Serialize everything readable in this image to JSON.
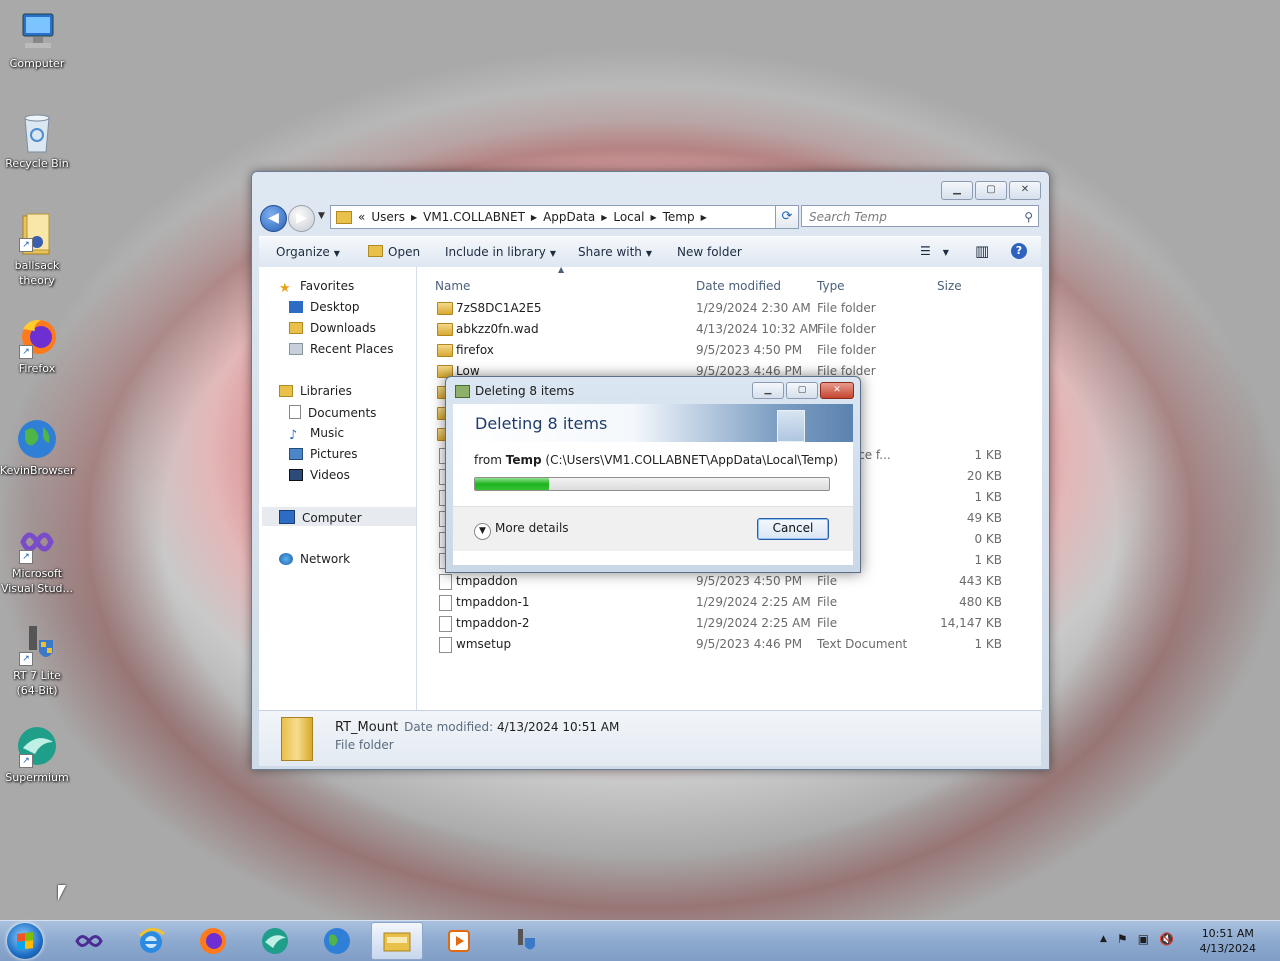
{
  "desktop": {
    "icons": [
      {
        "label": "Computer",
        "icon": "computer-icon"
      },
      {
        "label": "Recycle Bin",
        "icon": "recycle-bin-icon"
      },
      {
        "label": "ballsack theory",
        "icon": "folder-icon"
      },
      {
        "label": "Firefox",
        "icon": "firefox-icon"
      },
      {
        "label": "KevinBrowser",
        "icon": "globe-icon"
      },
      {
        "label": "Microsoft Visual Stud...",
        "icon": "visual-studio-icon"
      },
      {
        "label": "RT 7 Lite (64-Bit)",
        "icon": "rt7lite-icon"
      },
      {
        "label": "Supermium",
        "icon": "supermium-icon"
      }
    ]
  },
  "explorer": {
    "breadcrumb": [
      "«",
      "Users",
      "VM1.COLLABNET",
      "AppData",
      "Local",
      "Temp"
    ],
    "search_placeholder": "Search Temp",
    "toolbar": {
      "organize": "Organize",
      "open": "Open",
      "include": "Include in library",
      "share": "Share with",
      "new_folder": "New folder"
    },
    "nav": {
      "favorites": "Favorites",
      "desktop": "Desktop",
      "downloads": "Downloads",
      "recent": "Recent Places",
      "libraries": "Libraries",
      "documents": "Documents",
      "music": "Music",
      "pictures": "Pictures",
      "videos": "Videos",
      "computer": "Computer",
      "network": "Network"
    },
    "columns": {
      "name": "Name",
      "date": "Date modified",
      "type": "Type",
      "size": "Size"
    },
    "rows": [
      {
        "name": "7zS8DC1A2E5",
        "date": "1/29/2024 2:30 AM",
        "type": "File folder",
        "size": ""
      },
      {
        "name": "abkzz0fn.wad",
        "date": "4/13/2024 10:32 AM",
        "type": "File folder",
        "size": ""
      },
      {
        "name": "firefox",
        "date": "9/5/2023 4:50 PM",
        "type": "File folder",
        "size": ""
      },
      {
        "name": "Low",
        "date": "9/5/2023 4:46 PM",
        "type": "File folder",
        "size": ""
      },
      {
        "name": "",
        "date": "",
        "type": "er",
        "size": ""
      },
      {
        "name": "",
        "date": "",
        "type": "er",
        "size": ""
      },
      {
        "name": "",
        "date": "",
        "type": "er",
        "size": ""
      },
      {
        "name": "",
        "date": "",
        "type": "# Source f...",
        "size": "1 KB"
      },
      {
        "name": "",
        "date": "",
        "type": "ument",
        "size": "20 KB"
      },
      {
        "name": "",
        "date": "",
        "type": "ument",
        "size": "1 KB"
      },
      {
        "name": "",
        "date": "",
        "type": "image",
        "size": "49 KB"
      },
      {
        "name": "",
        "date": "",
        "type": "ument",
        "size": "0 KB"
      },
      {
        "name": "",
        "date": "",
        "type": "ument",
        "size": "1 KB"
      },
      {
        "name": "tmpaddon",
        "date": "9/5/2023 4:50 PM",
        "type": "File",
        "size": "443 KB"
      },
      {
        "name": "tmpaddon-1",
        "date": "1/29/2024 2:25 AM",
        "type": "File",
        "size": "480 KB"
      },
      {
        "name": "tmpaddon-2",
        "date": "1/29/2024 2:25 AM",
        "type": "File",
        "size": "14,147 KB"
      },
      {
        "name": "wmsetup",
        "date": "9/5/2023 4:46 PM",
        "type": "Text Document",
        "size": "1 KB"
      }
    ],
    "details": {
      "name": "RT_Mount",
      "date_label": "Date modified:",
      "date": "4/13/2024 10:51 AM",
      "type": "File folder"
    }
  },
  "dialog": {
    "title": "Deleting 8 items",
    "heading": "Deleting 8 items",
    "from_prefix": "from",
    "from_folder": "Temp",
    "from_path": "(C:\\Users\\VM1.COLLABNET\\AppData\\Local\\Temp)",
    "progress_percent": 21,
    "more_details": "More details",
    "cancel": "Cancel"
  },
  "taskbar": {
    "time": "10:51 AM",
    "date": "4/13/2024"
  }
}
